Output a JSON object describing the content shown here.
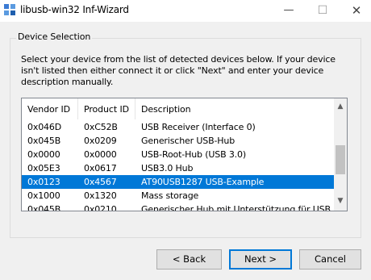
{
  "window": {
    "title": "libusb-win32 Inf-Wizard",
    "icon": "usb-wizard-icon",
    "controls": {
      "minimize": "—",
      "maximize": "☐",
      "close": "✕"
    }
  },
  "group": {
    "label": "Device Selection",
    "instructions": "Select your device from the list of detected devices below. If your device isn't listed then either connect it or click \"Next\" and enter your device description manually."
  },
  "list": {
    "headers": [
      "Vendor ID",
      "Product ID",
      "Description"
    ],
    "rows": [
      {
        "vendor": "0x046D",
        "product": "0xC52B",
        "description": "USB Receiver (Interface 0)"
      },
      {
        "vendor": "0x045B",
        "product": "0x0209",
        "description": "Generischer USB-Hub"
      },
      {
        "vendor": "0x0000",
        "product": "0x0000",
        "description": "USB-Root-Hub (USB 3.0)"
      },
      {
        "vendor": "0x05E3",
        "product": "0x0617",
        "description": "USB3.0 Hub"
      },
      {
        "vendor": "0x0123",
        "product": "0x4567",
        "description": "AT90USB1287 USB-Example"
      },
      {
        "vendor": "0x1000",
        "product": "0x1320",
        "description": "Mass storage"
      },
      {
        "vendor": "0x045B",
        "product": "0x0210",
        "description": "Generischer Hub mit Unterstützung für USB (C"
      }
    ],
    "selected_index": 4
  },
  "buttons": {
    "back": "< Back",
    "next": "Next >",
    "cancel": "Cancel"
  },
  "colors": {
    "selection": "#0078d7",
    "default_button_border": "#0078d7"
  }
}
